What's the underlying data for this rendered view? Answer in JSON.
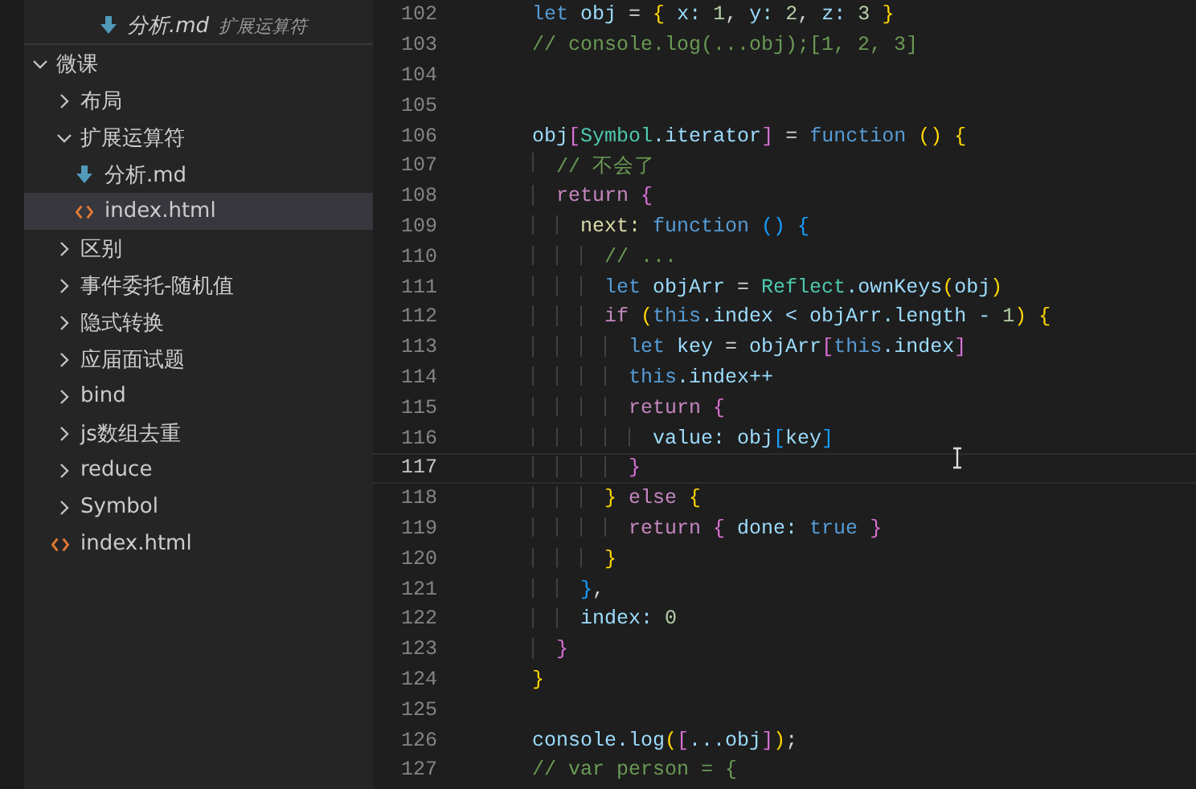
{
  "open_editor": {
    "kind": "md",
    "name": "分析.md",
    "folder": "扩展运算符"
  },
  "explorer": {
    "label": "微课",
    "kind": "folder",
    "expanded": true,
    "selected": false,
    "children": [
      {
        "label": "布局",
        "kind": "folder",
        "expanded": false,
        "selected": false
      },
      {
        "label": "扩展运算符",
        "kind": "folder",
        "expanded": true,
        "selected": false,
        "children": [
          {
            "label": "分析.md",
            "kind": "md",
            "selected": false
          },
          {
            "label": "index.html",
            "kind": "html",
            "selected": true
          }
        ]
      },
      {
        "label": "区别",
        "kind": "folder",
        "expanded": false,
        "selected": false
      },
      {
        "label": "事件委托-随机值",
        "kind": "folder",
        "expanded": false,
        "selected": false
      },
      {
        "label": "隐式转换",
        "kind": "folder",
        "expanded": false,
        "selected": false
      },
      {
        "label": "应届面试题",
        "kind": "folder",
        "expanded": false,
        "selected": false
      },
      {
        "label": "bind",
        "kind": "folder",
        "expanded": false,
        "selected": false
      },
      {
        "label": "js数组去重",
        "kind": "folder",
        "expanded": false,
        "selected": false
      },
      {
        "label": "reduce",
        "kind": "folder",
        "expanded": false,
        "selected": false
      },
      {
        "label": "Symbol",
        "kind": "folder",
        "expanded": false,
        "selected": false
      },
      {
        "label": "index.html",
        "kind": "html",
        "selected": false
      }
    ]
  },
  "editor": {
    "lines": [
      {
        "number": "102",
        "current": false,
        "tokens": [
          {
            "text": "let",
            "kind": "kw"
          },
          {
            "text": " obj",
            "kind": "var"
          },
          {
            "text": " = ",
            "kind": "punc"
          },
          {
            "text": "{",
            "kind": "b1"
          },
          {
            "text": " x: ",
            "kind": "var"
          },
          {
            "text": "1",
            "kind": "num"
          },
          {
            "text": ", ",
            "kind": "punc"
          },
          {
            "text": "y: ",
            "kind": "var"
          },
          {
            "text": "2",
            "kind": "num"
          },
          {
            "text": ", ",
            "kind": "punc"
          },
          {
            "text": "z: ",
            "kind": "var"
          },
          {
            "text": "3 ",
            "kind": "num"
          },
          {
            "text": "}",
            "kind": "b1"
          }
        ]
      },
      {
        "number": "103",
        "current": false,
        "tokens": [
          {
            "text": "// console.log(...obj);[1, 2, 3]",
            "kind": "cm"
          }
        ]
      },
      {
        "number": "104",
        "current": false
      },
      {
        "number": "105",
        "current": false
      },
      {
        "number": "106",
        "current": false,
        "tokens": [
          {
            "text": "obj",
            "kind": "var"
          },
          {
            "text": "[",
            "kind": "b2"
          },
          {
            "text": "Symbol",
            "kind": "type"
          },
          {
            "text": ".iterator",
            "kind": "var"
          },
          {
            "text": "]",
            "kind": "b2"
          },
          {
            "text": " = ",
            "kind": "punc"
          },
          {
            "text": "function",
            "kind": "kw"
          },
          {
            "text": " ()",
            "kind": "b1"
          },
          {
            "text": " {",
            "kind": "b1"
          }
        ]
      },
      {
        "number": "107",
        "current": false,
        "tokens": [
          {
            "text": "  // 不会了",
            "kind": "cm"
          }
        ]
      },
      {
        "number": "108",
        "current": false,
        "tokens": [
          {
            "text": "  return",
            "kind": "ctrl"
          },
          {
            "text": " {",
            "kind": "b2"
          }
        ]
      },
      {
        "number": "109",
        "current": false,
        "tokens": [
          {
            "text": "    next:",
            "kind": "fn"
          },
          {
            "text": " function",
            "kind": "kw"
          },
          {
            "text": " () {",
            "kind": "b3"
          }
        ]
      },
      {
        "number": "110",
        "current": false,
        "tokens": [
          {
            "text": "      // ...",
            "kind": "cm"
          }
        ]
      },
      {
        "number": "111",
        "current": false,
        "tokens": [
          {
            "text": "      let",
            "kind": "kw"
          },
          {
            "text": " objArr",
            "kind": "var"
          },
          {
            "text": " = ",
            "kind": "punc"
          },
          {
            "text": "Reflect",
            "kind": "type"
          },
          {
            "text": ".ownKeys",
            "kind": "var"
          },
          {
            "text": "(",
            "kind": "b1"
          },
          {
            "text": "obj",
            "kind": "var"
          },
          {
            "text": ")",
            "kind": "b1"
          }
        ]
      },
      {
        "number": "112",
        "current": false,
        "tokens": [
          {
            "text": "      if",
            "kind": "ctrl"
          },
          {
            "text": " (",
            "kind": "b1"
          },
          {
            "text": "this",
            "kind": "kw"
          },
          {
            "text": ".index < objArr.length - ",
            "kind": "var"
          },
          {
            "text": "1",
            "kind": "num"
          },
          {
            "text": ")",
            "kind": "b1"
          },
          {
            "text": " {",
            "kind": "b1"
          }
        ]
      },
      {
        "number": "113",
        "current": false,
        "tokens": [
          {
            "text": "        let",
            "kind": "kw"
          },
          {
            "text": " key",
            "kind": "var"
          },
          {
            "text": " = ",
            "kind": "punc"
          },
          {
            "text": "objArr",
            "kind": "var"
          },
          {
            "text": "[",
            "kind": "b2"
          },
          {
            "text": "this",
            "kind": "kw"
          },
          {
            "text": ".index",
            "kind": "var"
          },
          {
            "text": "]",
            "kind": "b2"
          }
        ]
      },
      {
        "number": "114",
        "current": false,
        "tokens": [
          {
            "text": "        this",
            "kind": "kw"
          },
          {
            "text": ".index++",
            "kind": "var"
          }
        ]
      },
      {
        "number": "115",
        "current": false,
        "tokens": [
          {
            "text": "        return",
            "kind": "ctrl"
          },
          {
            "text": " {",
            "kind": "b2"
          }
        ]
      },
      {
        "number": "116",
        "current": false,
        "tokens": [
          {
            "text": "          value: obj",
            "kind": "var"
          },
          {
            "text": "[",
            "kind": "b3"
          },
          {
            "text": "key",
            "kind": "var"
          },
          {
            "text": "]",
            "kind": "b3"
          }
        ]
      },
      {
        "number": "117",
        "current": true,
        "tokens": [
          {
            "text": "        }",
            "kind": "b2"
          }
        ]
      },
      {
        "number": "118",
        "current": false,
        "tokens": [
          {
            "text": "      }",
            "kind": "b1"
          },
          {
            "text": " else",
            "kind": "ctrl"
          },
          {
            "text": " {",
            "kind": "b1"
          }
        ]
      },
      {
        "number": "119",
        "current": false,
        "tokens": [
          {
            "text": "        return",
            "kind": "ctrl"
          },
          {
            "text": " {",
            "kind": "b2"
          },
          {
            "text": " done: ",
            "kind": "var"
          },
          {
            "text": "true",
            "kind": "kw"
          },
          {
            "text": " }",
            "kind": "b2"
          }
        ]
      },
      {
        "number": "120",
        "current": false,
        "tokens": [
          {
            "text": "      }",
            "kind": "b1"
          }
        ]
      },
      {
        "number": "121",
        "current": false,
        "tokens": [
          {
            "text": "    }",
            "kind": "b3"
          },
          {
            "text": ",",
            "kind": "punc"
          }
        ]
      },
      {
        "number": "122",
        "current": false,
        "tokens": [
          {
            "text": "    index: ",
            "kind": "var"
          },
          {
            "text": "0",
            "kind": "num"
          }
        ]
      },
      {
        "number": "123",
        "current": false,
        "tokens": [
          {
            "text": "  }",
            "kind": "b2"
          }
        ]
      },
      {
        "number": "124",
        "current": false,
        "tokens": [
          {
            "text": "}",
            "kind": "b1"
          }
        ]
      },
      {
        "number": "125",
        "current": false
      },
      {
        "number": "126",
        "current": false,
        "tokens": [
          {
            "text": "console.log",
            "kind": "var"
          },
          {
            "text": "(",
            "kind": "b1"
          },
          {
            "text": "[",
            "kind": "b2"
          },
          {
            "text": "...obj",
            "kind": "var"
          },
          {
            "text": "]",
            "kind": "b2"
          },
          {
            "text": ")",
            "kind": "b1"
          },
          {
            "text": ";",
            "kind": "punc"
          }
        ]
      },
      {
        "number": "127",
        "current": false,
        "tokens": [
          {
            "text": "// var person = {",
            "kind": "cm"
          }
        ]
      }
    ]
  }
}
